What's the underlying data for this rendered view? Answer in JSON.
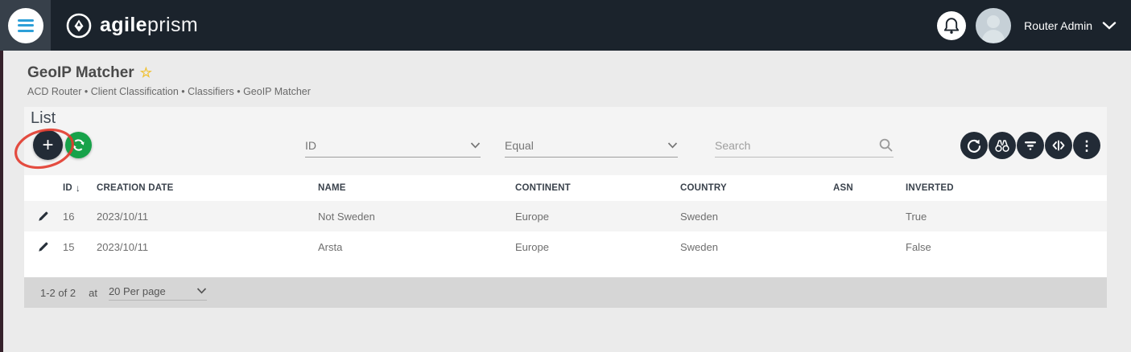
{
  "header": {
    "brand_agile": "agile",
    "brand_prism": "prism",
    "user_name": "Router Admin"
  },
  "page": {
    "title": "GeoIP Matcher",
    "breadcrumb": "ACD Router • Client Classification • Classifiers • GeoIP Matcher"
  },
  "list": {
    "title": "List",
    "filter": {
      "field": "ID",
      "operator": "Equal",
      "search_placeholder": "Search"
    },
    "table": {
      "columns": [
        "ID",
        "CREATION DATE",
        "NAME",
        "CONTINENT",
        "COUNTRY",
        "ASN",
        "INVERTED"
      ],
      "rows": [
        {
          "id": "16",
          "creation_date": "2023/10/11",
          "name": "Not Sweden",
          "continent": "Europe",
          "country": "Sweden",
          "asn": "",
          "inverted": "True"
        },
        {
          "id": "15",
          "creation_date": "2023/10/11",
          "name": "Arsta",
          "continent": "Europe",
          "country": "Sweden",
          "asn": "",
          "inverted": "False"
        }
      ]
    },
    "pagination": {
      "range": "1-2 of 2",
      "at": "at",
      "per_page": "20 Per page"
    }
  },
  "glyphs": {
    "plus": "+",
    "star": "☆",
    "sort_desc": "↓",
    "kebab": "⋮"
  },
  "colors": {
    "topbar_bg": "#1b232c",
    "button_navy": "#222b36",
    "accent_green": "#17a24a",
    "hamburger_blue": "#2d9fd8",
    "star_gold": "#f0c02f",
    "annotation_red": "#e23a2c",
    "footer_gray": "#d6d6d6"
  },
  "icons": {
    "left_buttons": [
      "plus-icon",
      "sync-icon"
    ],
    "right_buttons": [
      "refresh-icon",
      "binoculars-icon",
      "filter-icon",
      "resize-columns-icon",
      "more-vertical-icon"
    ]
  }
}
